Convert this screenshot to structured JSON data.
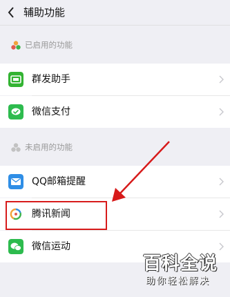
{
  "header": {
    "title": "辅助功能",
    "back_icon": "chevron-left-icon"
  },
  "enabled_section": {
    "label": "已启用的功能",
    "items": [
      {
        "label": "群发助手",
        "icon": "broadcast-icon",
        "color": "#33b332"
      },
      {
        "label": "微信支付",
        "icon": "wechat-pay-icon",
        "color": "#2dbb4e"
      }
    ]
  },
  "disabled_section": {
    "label": "未启用的功能",
    "items": [
      {
        "label": "QQ邮箱提醒",
        "icon": "mail-icon",
        "color": "#2f8ee6"
      },
      {
        "label": "腾讯新闻",
        "icon": "tencent-news-icon",
        "color": "#ffffff"
      },
      {
        "label": "微信运动",
        "icon": "wechat-sport-icon",
        "color": "#2dbb4e"
      }
    ]
  },
  "watermark": {
    "title": "百科全说",
    "subtitle": "助你轻松解决"
  },
  "colors": {
    "annotation_red": "#d71a1a",
    "background": "#efeff4"
  }
}
